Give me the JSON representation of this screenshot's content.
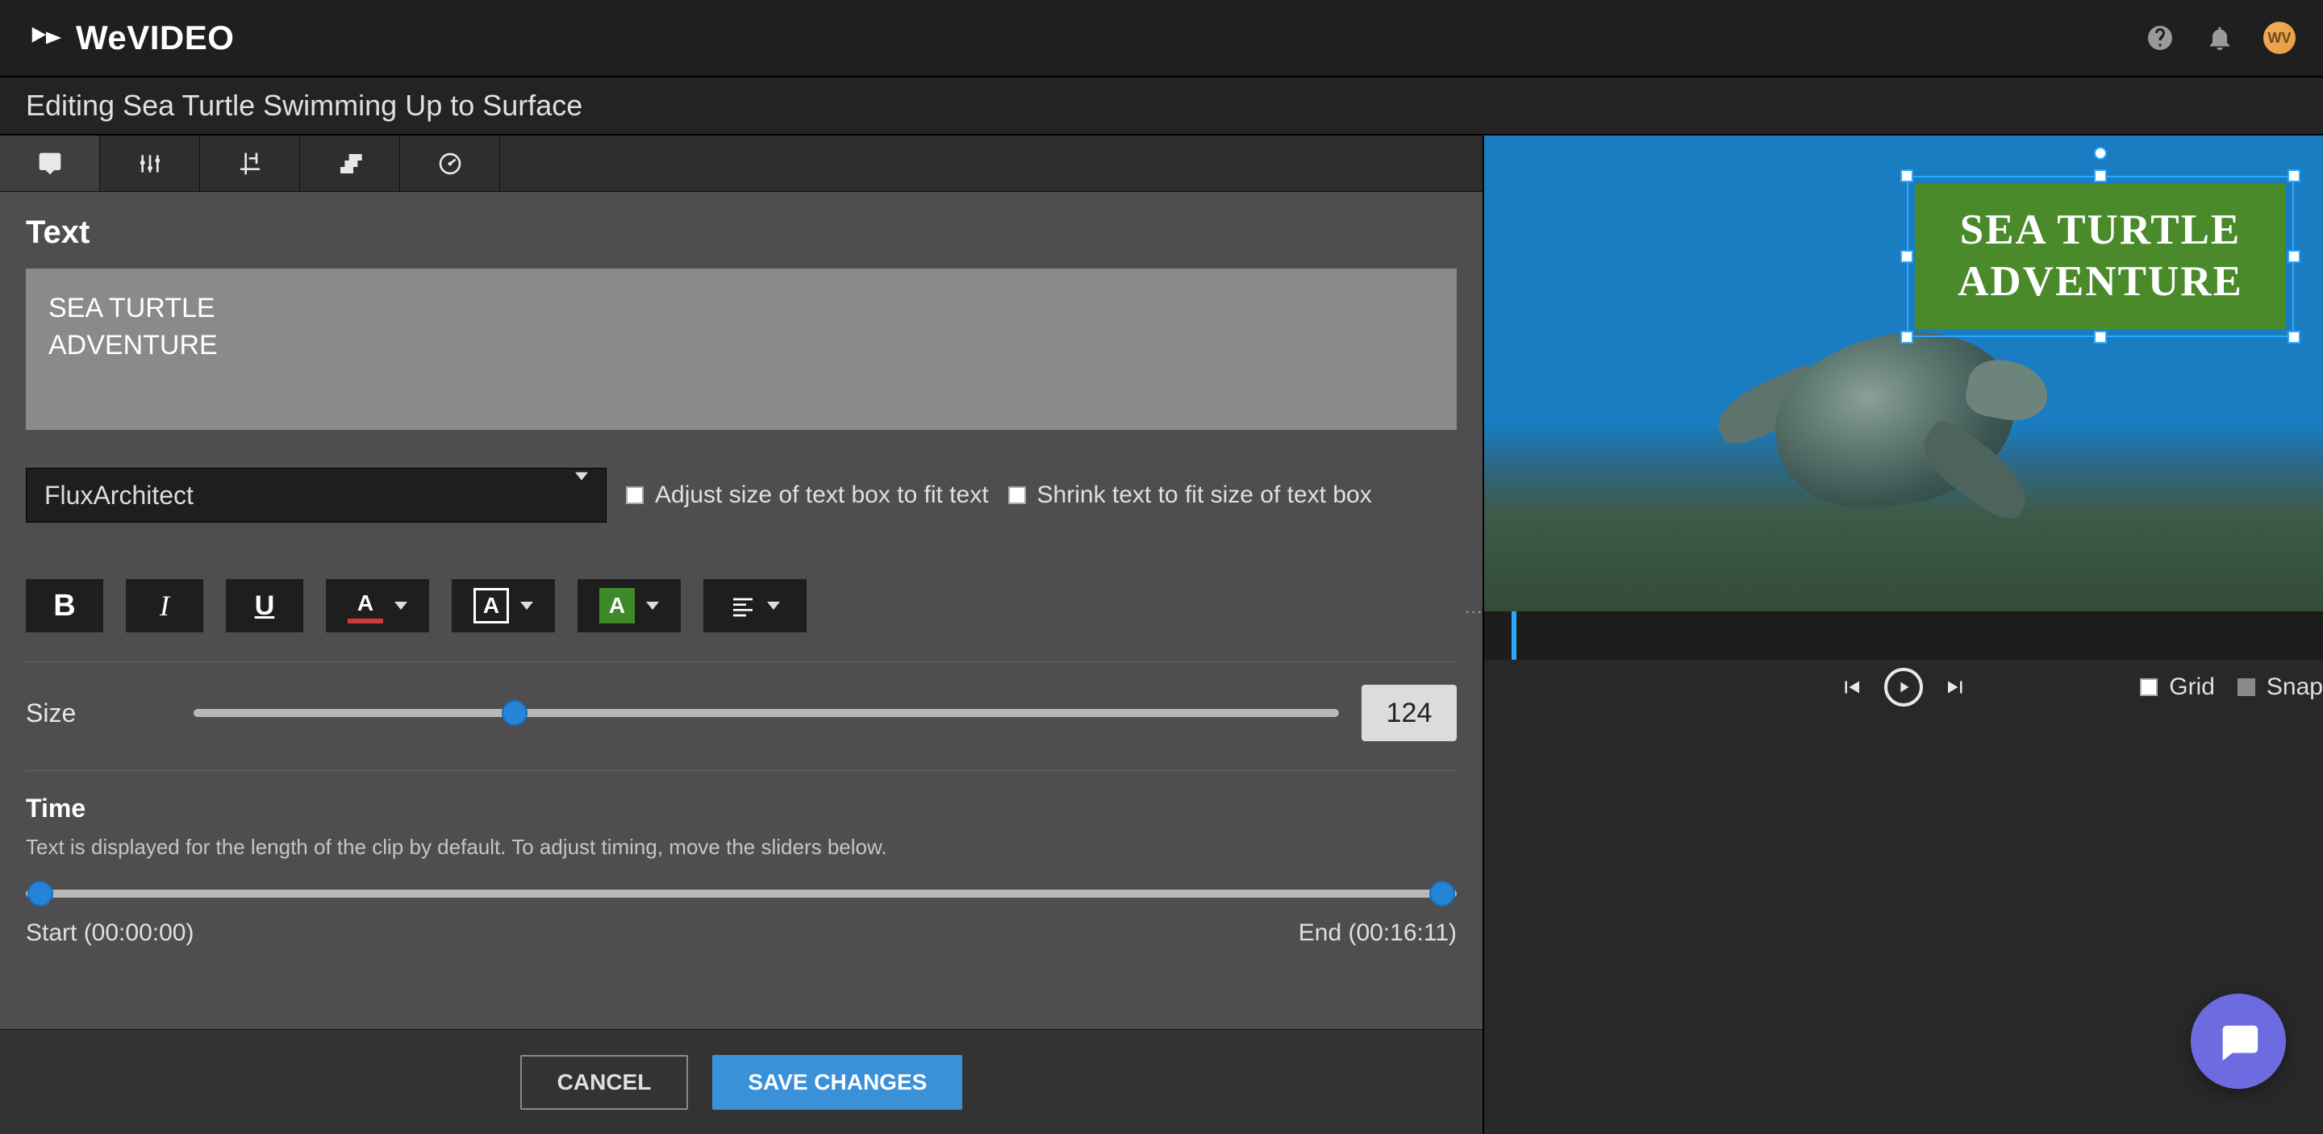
{
  "brand": {
    "name": "WeVIDEO",
    "avatar_initials": "WV"
  },
  "page_title": "Editing Sea Turtle Swimming Up to Surface",
  "panel": {
    "heading": "Text",
    "text_value": "SEA TURTLE\nADVENTURE",
    "font_name": "FluxArchitect",
    "adjust_box_label": "Adjust size of text box to fit text",
    "shrink_text_label": "Shrink text to fit size of text box",
    "size_label": "Size",
    "size_value": "124",
    "size_percent": 28,
    "time_label": "Time",
    "time_help": "Text is displayed for the length of the clip by default. To adjust timing, move the sliders below.",
    "time_start_label": "Start (00:00:00)",
    "time_end_label": "End (00:16:11)",
    "time_start_percent": 1,
    "time_end_percent": 99
  },
  "actions": {
    "cancel": "CANCEL",
    "save": "SAVE CHANGES"
  },
  "preview": {
    "title_line1": "SEA TURTLE",
    "title_line2": "ADVENTURE",
    "grid_label": "Grid",
    "snap_label": "Snap"
  }
}
